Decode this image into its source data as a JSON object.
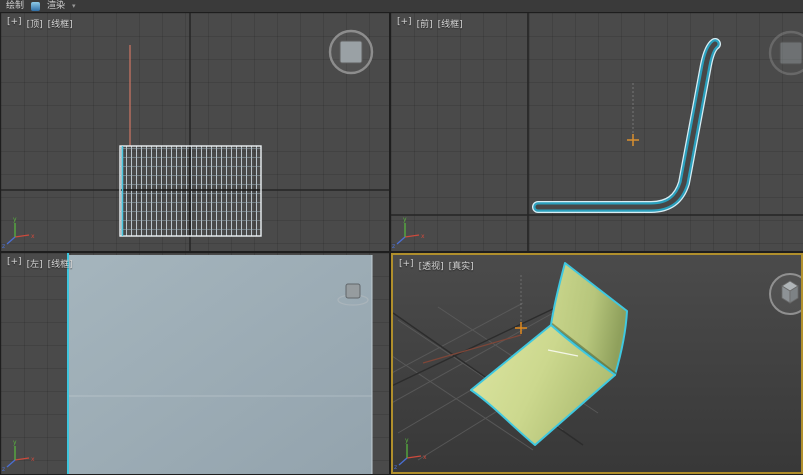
{
  "menubar": {
    "items": [
      {
        "label": "绘制"
      },
      {
        "label": "渲染"
      }
    ]
  },
  "viewports": {
    "top": {
      "plus": "[+]",
      "name": "[顶]",
      "shading": "[线框]"
    },
    "front": {
      "plus": "[+]",
      "name": "[前]",
      "shading": "[线框]"
    },
    "left": {
      "plus": "[+]",
      "name": "[左]",
      "shading": "[线框]"
    },
    "perspective": {
      "plus": "[+]",
      "name": "[透视]",
      "shading": "[真实]"
    }
  },
  "axis": {
    "x": "x",
    "y": "y",
    "z": "z"
  },
  "colors": {
    "selection_cyan": "#3ec6de",
    "active_viewport_border": "#b08f2c",
    "object_fill_green": "#ccd88e",
    "left_view_plane": "#9cadb6",
    "viewport_background": "#4a4a4a",
    "pivot_orange": "#e08a1e"
  }
}
